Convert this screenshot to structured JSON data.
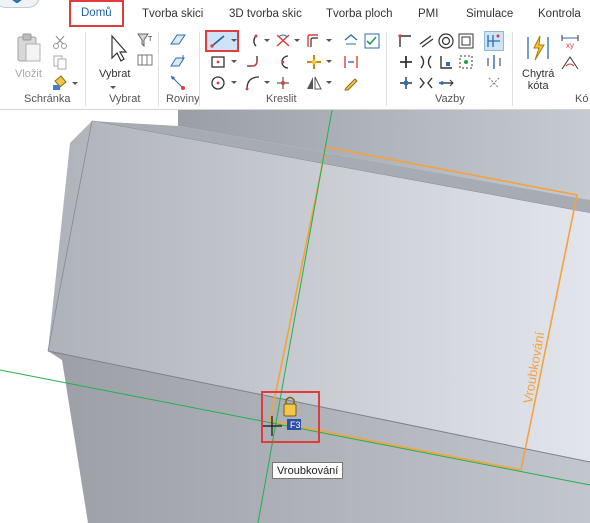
{
  "ribbon": {
    "tabs": [
      {
        "label": "Domů",
        "active": true
      },
      {
        "label": "Tvorba skici"
      },
      {
        "label": "3D tvorba skic"
      },
      {
        "label": "Tvorba ploch"
      },
      {
        "label": "PMI"
      },
      {
        "label": "Simulace"
      },
      {
        "label": "Kontrola"
      }
    ],
    "groups": {
      "clipboard": {
        "label": "Schránka",
        "paste_label": "Vložit"
      },
      "select": {
        "label": "Vybrat",
        "select_label": "Vybrat"
      },
      "planes": {
        "label": "Roviny"
      },
      "draw": {
        "label": "Kreslit"
      },
      "relations": {
        "label": "Vazby"
      },
      "dimension": {
        "smart_label_line1": "Chytrá",
        "smart_label_line2": "kóta",
        "partial_label": "Kó"
      }
    }
  },
  "viewport": {
    "sketch_label": "Vroubkování",
    "tooltip": "Vroubkování",
    "cursor_badge": "F3"
  },
  "colors": {
    "accent_blue": "#1f5fa8",
    "highlight_red": "#e03c3c",
    "sketch_orange": "#f5a23c",
    "axis_green": "#22b14c",
    "model_grey": "#b8bcc4"
  }
}
